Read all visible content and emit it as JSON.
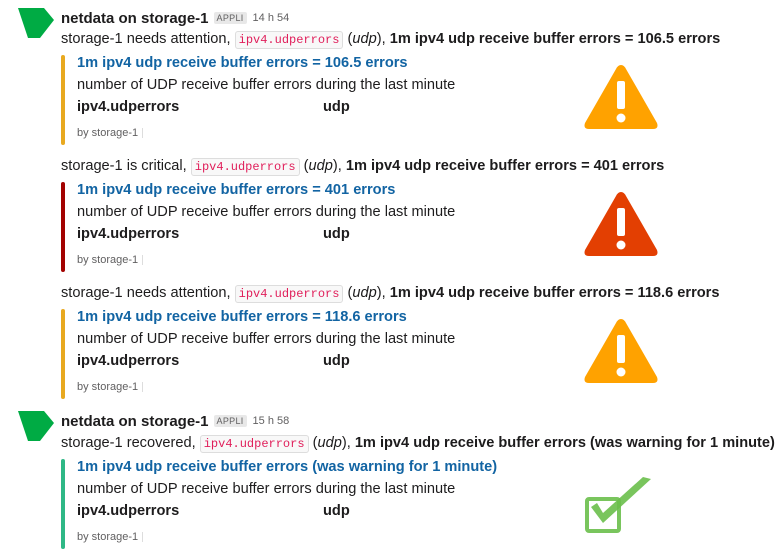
{
  "colors": {
    "warning": "#e8a920",
    "critical": "#a30200",
    "clear": "#2eb886",
    "link": "#1264a3",
    "code": "#e01e5a",
    "warning_icon": "#ffa200",
    "critical_icon": "#e33f02",
    "clear_icon": "#6abf4b"
  },
  "groups": [
    {
      "sender": "netdata on storage-1",
      "badge": "APPLI",
      "time": "14 h 54",
      "messages": [
        {
          "pre": "storage-1 needs attention, ",
          "chart": "ipv4.udperrors",
          "open": " (",
          "family": "udp",
          "close": "), ",
          "bold": "1m ipv4 udp receive buffer errors = 106.5 errors",
          "status": "warning",
          "icon": "warning-triangle-icon",
          "title": "1m ipv4 udp receive buffer errors = 106.5 errors",
          "desc": "number of UDP receive buffer errors during the last minute",
          "field_chart": "ipv4.udperrors",
          "field_family": "udp",
          "footer": "by storage-1"
        },
        {
          "pre": "storage-1 is critical, ",
          "chart": "ipv4.udperrors",
          "open": " (",
          "family": "udp",
          "close": "), ",
          "bold": "1m ipv4 udp receive buffer errors = 401 errors",
          "status": "critical",
          "icon": "critical-triangle-icon",
          "title": "1m ipv4 udp receive buffer errors = 401 errors",
          "desc": "number of UDP receive buffer errors during the last minute",
          "field_chart": "ipv4.udperrors",
          "field_family": "udp",
          "footer": "by storage-1"
        },
        {
          "pre": "storage-1 needs attention, ",
          "chart": "ipv4.udperrors",
          "open": " (",
          "family": "udp",
          "close": "), ",
          "bold": "1m ipv4 udp receive buffer errors = 118.6 errors",
          "status": "warning",
          "icon": "warning-triangle-icon",
          "title": "1m ipv4 udp receive buffer errors = 118.6 errors",
          "desc": "number of UDP receive buffer errors during the last minute",
          "field_chart": "ipv4.udperrors",
          "field_family": "udp",
          "footer": "by storage-1"
        }
      ]
    },
    {
      "sender": "netdata on storage-1",
      "badge": "APPLI",
      "time": "15 h 58",
      "messages": [
        {
          "pre": "storage-1 recovered, ",
          "chart": "ipv4.udperrors",
          "open": " (",
          "family": "udp",
          "close": "), ",
          "bold": "1m ipv4 udp receive buffer errors (was warning for 1 minute)",
          "status": "clear",
          "icon": "checkmark-icon",
          "title": "1m ipv4 udp receive buffer errors (was warning for 1 minute)",
          "desc": "number of UDP receive buffer errors during the last minute",
          "field_chart": "ipv4.udperrors",
          "field_family": "udp",
          "footer": "by storage-1"
        }
      ]
    }
  ]
}
